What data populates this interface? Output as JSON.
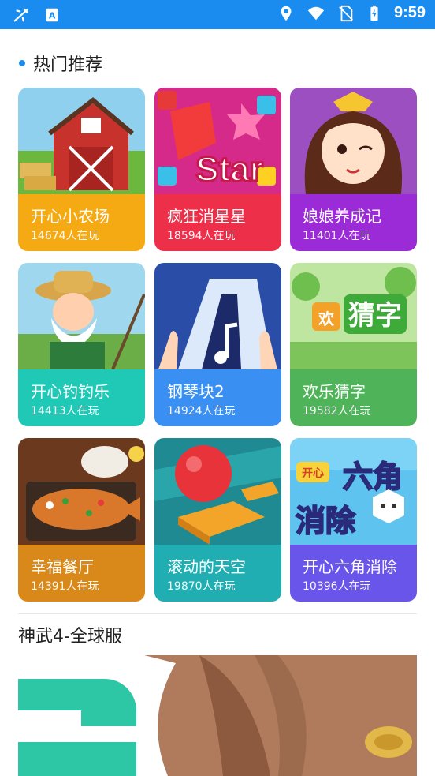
{
  "statusbar": {
    "time": "9:59",
    "icons": [
      "airplane-tool-icon",
      "font-a-icon",
      "location-icon",
      "wifi-icon",
      "no-sim-icon",
      "battery-charging-icon"
    ]
  },
  "section": {
    "title": "热门推荐"
  },
  "games": [
    {
      "name": "开心小农场",
      "players": "14674人在玩",
      "color": "#f5a913"
    },
    {
      "name": "疯狂消星星",
      "players": "18594人在玩",
      "color": "#ee2f4a"
    },
    {
      "name": "娘娘养成记",
      "players": "11401人在玩",
      "color": "#9a2bd6"
    },
    {
      "name": "开心钓钓乐",
      "players": "14413人在玩",
      "color": "#20c9b5"
    },
    {
      "name": "钢琴块2",
      "players": "14924人在玩",
      "color": "#3a8ff2"
    },
    {
      "name": "欢乐猜字",
      "players": "19582人在玩",
      "color": "#4fb35a"
    },
    {
      "name": "幸福餐厅",
      "players": "14391人在玩",
      "color": "#d9881a"
    },
    {
      "name": "滚动的天空",
      "players": "19870人在玩",
      "color": "#21aeb2"
    },
    {
      "name": "开心六角消除",
      "players": "10396人在玩",
      "color": "#6a55ea"
    }
  ],
  "banner": {
    "title": "神武4-全球服"
  }
}
